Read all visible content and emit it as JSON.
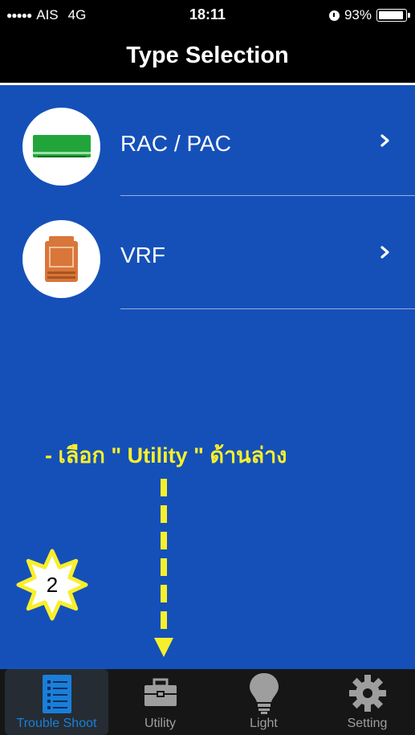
{
  "status_bar": {
    "carrier": "AIS",
    "network": "4G",
    "time": "18:11",
    "battery": "93%"
  },
  "nav": {
    "title": "Type Selection"
  },
  "types": [
    {
      "label": "RAC / PAC",
      "icon": "air-conditioner-icon"
    },
    {
      "label": "VRF",
      "icon": "outdoor-unit-icon"
    }
  ],
  "annotation": {
    "text": "- เลือก \" Utility \" ด้านล่าง",
    "step": "2",
    "color": "#f8ef2c"
  },
  "tabs": [
    {
      "label": "Trouble Shoot",
      "icon": "list-icon",
      "active": true
    },
    {
      "label": "Utility",
      "icon": "toolbox-icon",
      "active": false
    },
    {
      "label": "Light",
      "icon": "bulb-icon",
      "active": false
    },
    {
      "label": "Setting",
      "icon": "gear-icon",
      "active": false
    }
  ],
  "colors": {
    "background": "#1550b8",
    "tab_active": "#1a7fd8",
    "rac_icon": "#21a53a",
    "vrf_icon": "#d9763a"
  }
}
